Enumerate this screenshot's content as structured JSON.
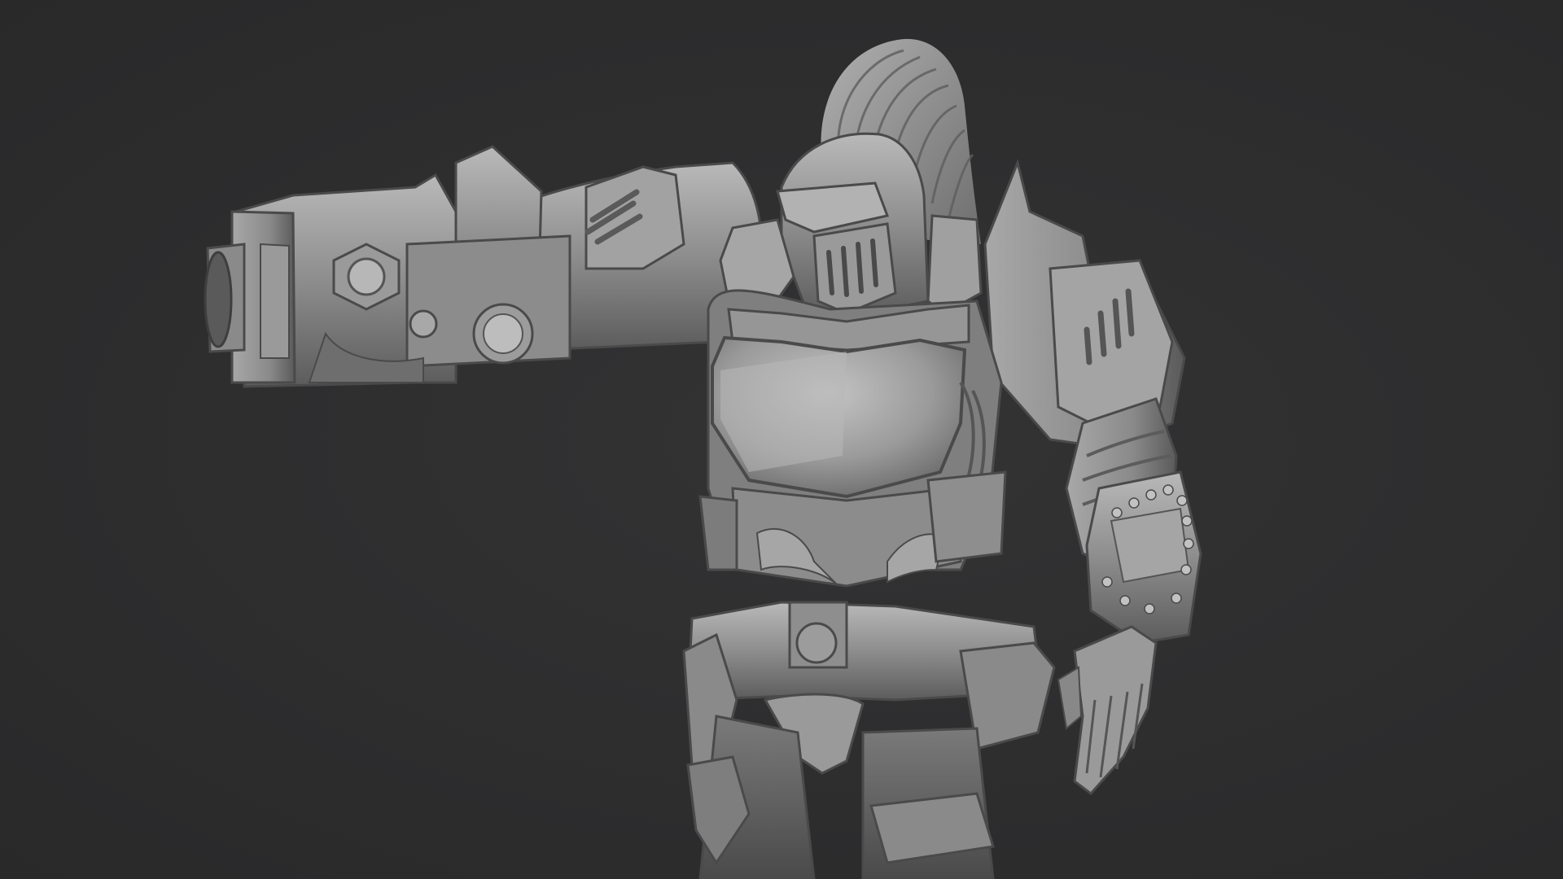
{
  "viewport": {
    "background_color": "#2e2e2f",
    "model_color": "#8f8f8f",
    "subject": "armored-knight-sculpt",
    "render_style": "clay-matcap-grey"
  }
}
